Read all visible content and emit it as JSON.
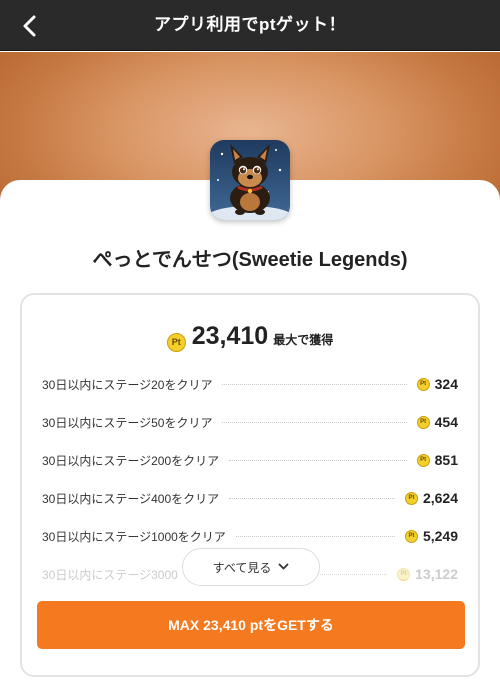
{
  "header": {
    "title": "アプリ利用でptゲット！",
    "back_icon": "chevron-left-icon"
  },
  "app": {
    "name": "ぺっとでんせつ(Sweetie Legends)",
    "icon": "puppy-app-icon"
  },
  "reward": {
    "coin_icon": "pt-coin-icon",
    "coin_text": "Pt",
    "max_amount": "23,410",
    "max_suffix": "最大で獲得"
  },
  "tasks": [
    {
      "label": "30日以内にステージ20をクリア",
      "points": "324"
    },
    {
      "label": "30日以内にステージ50をクリア",
      "points": "454"
    },
    {
      "label": "30日以内にステージ200をクリア",
      "points": "851"
    },
    {
      "label": "30日以内にステージ400をクリア",
      "points": "2,624"
    },
    {
      "label": "30日以内にステージ1000をクリア",
      "points": "5,249"
    },
    {
      "label": "30日以内にステージ3000",
      "points": "13,122"
    }
  ],
  "see_all": {
    "label": "すべて見る",
    "icon": "chevron-down-icon"
  },
  "cta": {
    "label": "MAX 23,410 ptをGETする"
  },
  "colors": {
    "header_bg": "#2a2a2a",
    "accent": "#f4791f",
    "coin": "#f4cf2a",
    "banner": "#d99564"
  }
}
